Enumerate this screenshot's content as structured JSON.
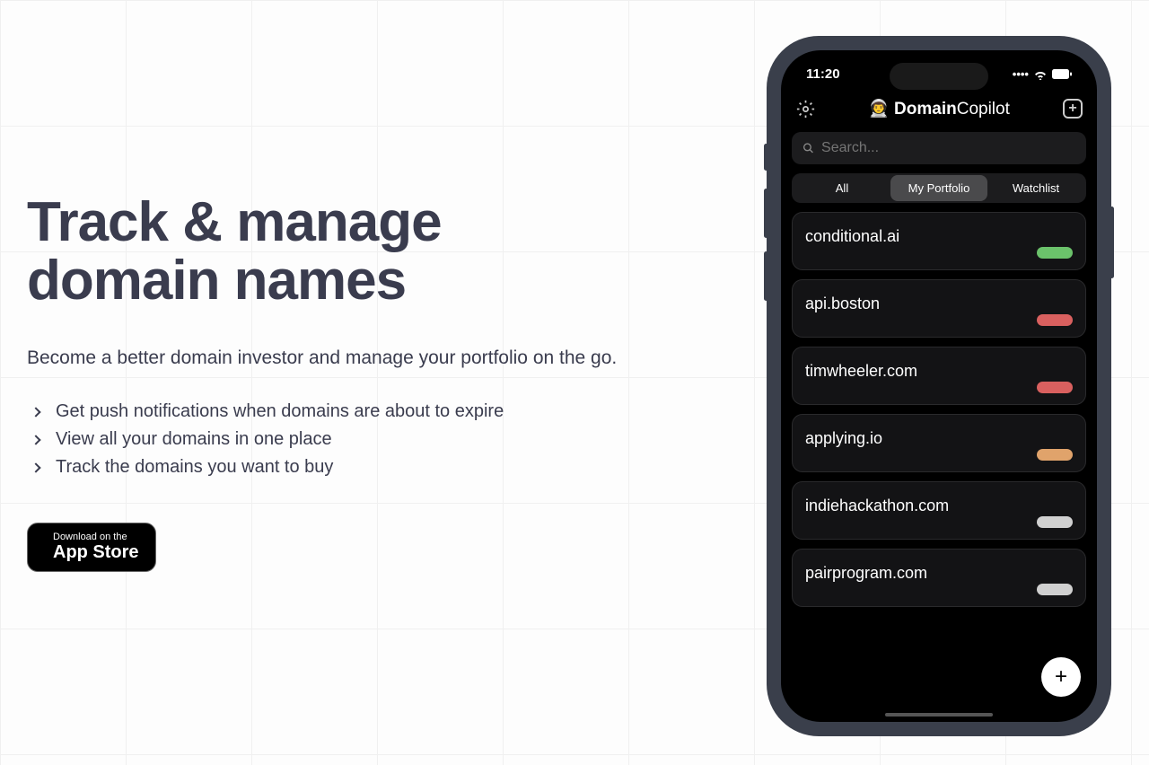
{
  "hero": {
    "headline_l1": "Track & manage",
    "headline_l2": "domain names",
    "subhead": "Become a better domain investor and manage your portfolio on the go.",
    "features": [
      "Get push notifications when domains are about to expire",
      "View all your domains in one place",
      "Track the domains you want to buy"
    ],
    "appstore_small": "Download on the",
    "appstore_big": "App Store"
  },
  "phone": {
    "time": "11:20",
    "app_name_bold": "Domain",
    "app_name_light": "Copilot",
    "search_placeholder": "Search...",
    "tabs": [
      "All",
      "My Portfolio",
      "Watchlist"
    ],
    "active_tab": 1,
    "domains": [
      {
        "name": "conditional.ai",
        "status": "green"
      },
      {
        "name": "api.boston",
        "status": "red"
      },
      {
        "name": "timwheeler.com",
        "status": "red"
      },
      {
        "name": "applying.io",
        "status": "orange"
      },
      {
        "name": "indiehackathon.com",
        "status": "gray"
      },
      {
        "name": "pairprogram.com",
        "status": "gray"
      }
    ]
  }
}
